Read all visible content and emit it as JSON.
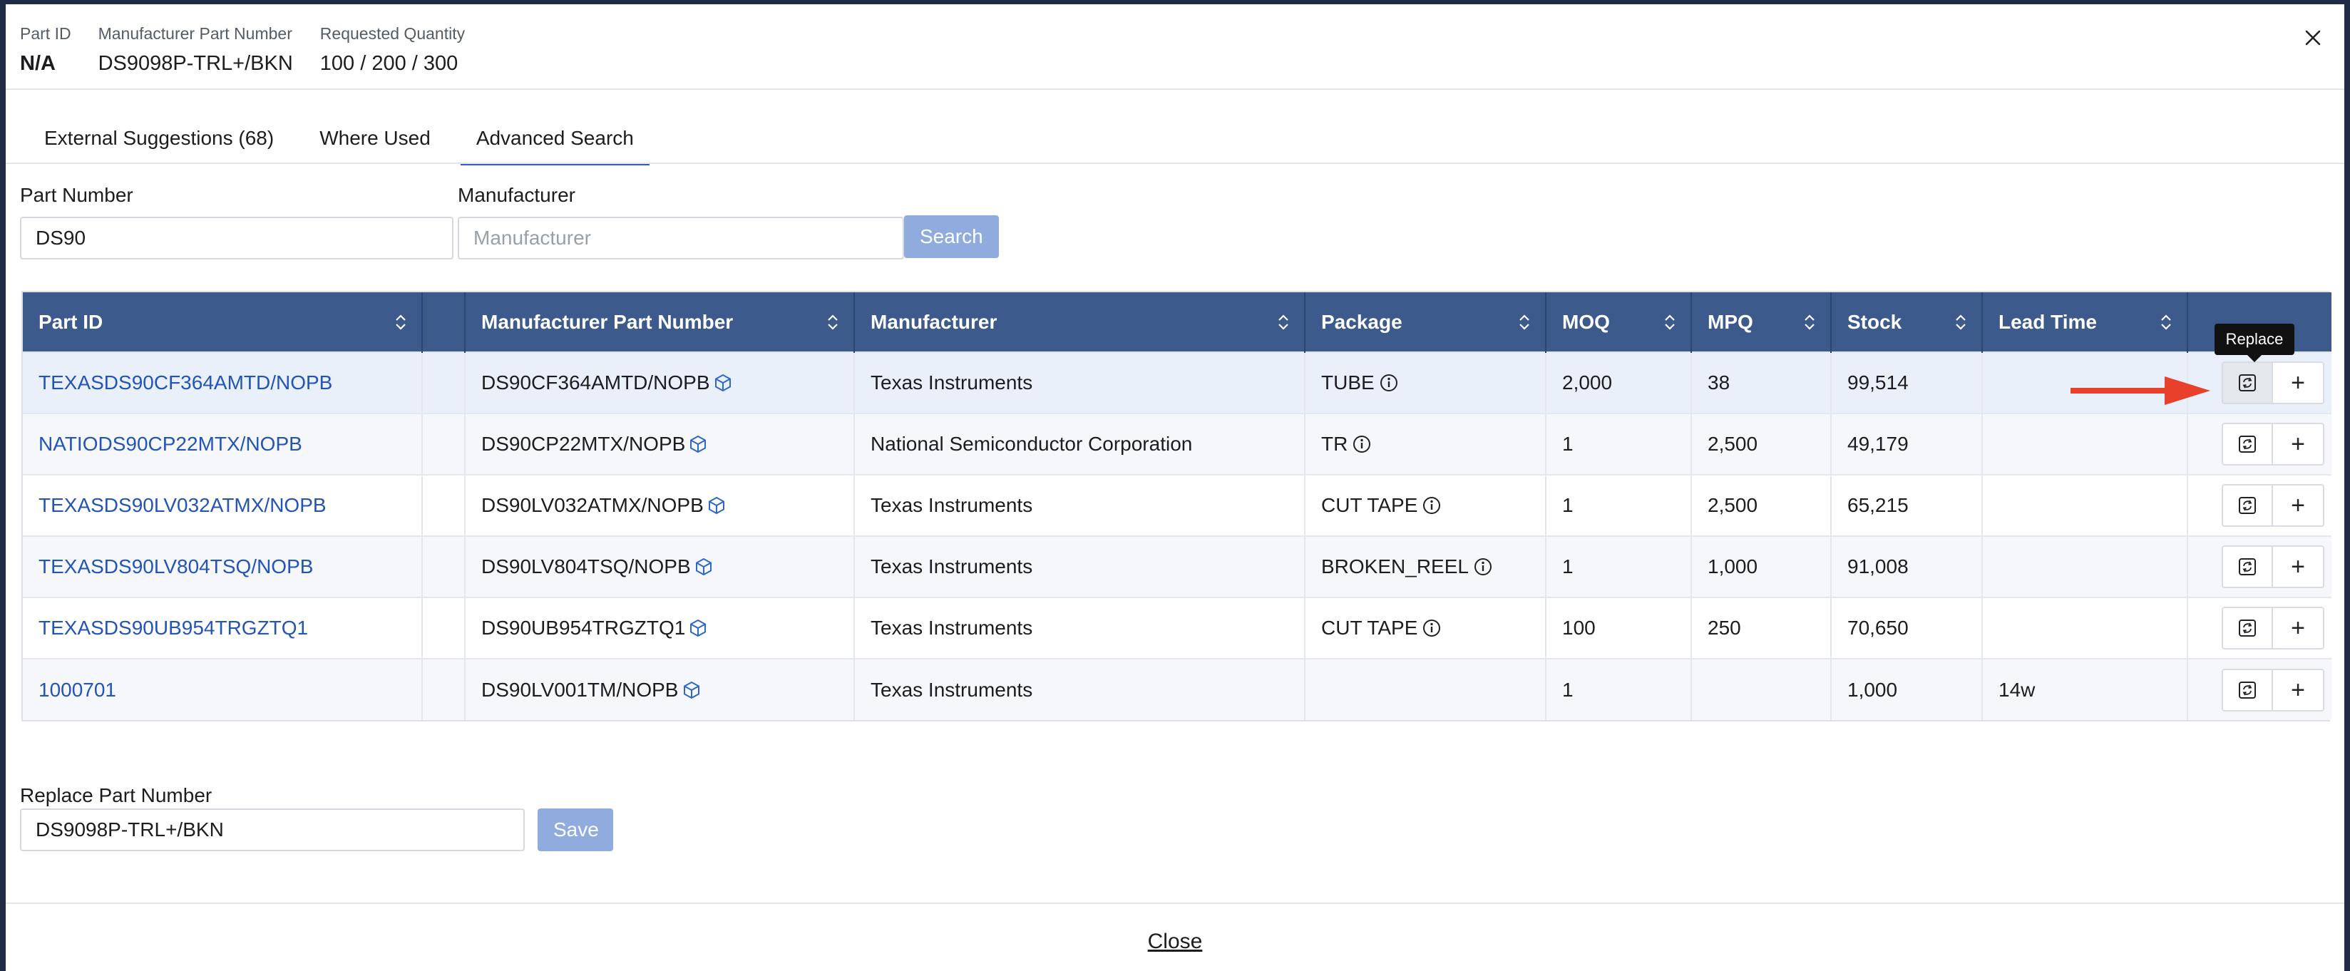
{
  "header": {
    "part_id_label": "Part ID",
    "part_id_value": "N/A",
    "mpn_label": "Manufacturer Part Number",
    "mpn_value": "DS9098P-TRL+/BKN",
    "qty_label": "Requested Quantity",
    "qty_value": "100 / 200 / 300",
    "close_icon": "close-icon"
  },
  "tabs": [
    {
      "label": "External Suggestions (68)",
      "active": false
    },
    {
      "label": "Where Used",
      "active": false
    },
    {
      "label": "Advanced Search",
      "active": true
    }
  ],
  "search": {
    "part_number_label": "Part Number",
    "part_number_value": "DS90",
    "manufacturer_label": "Manufacturer",
    "manufacturer_placeholder": "Manufacturer",
    "search_button": "Search"
  },
  "table": {
    "columns": [
      "Part ID",
      "",
      "Manufacturer Part Number",
      "Manufacturer",
      "Package",
      "MOQ",
      "MPQ",
      "Stock",
      "Lead Time",
      ""
    ],
    "rows": [
      {
        "part_id": "TEXASDS90CF364AMTD/NOPB",
        "mpn": "DS90CF364AMTD/NOPB",
        "manufacturer": "Texas Instruments",
        "package": "TUBE",
        "moq": "2,000",
        "mpq": "38",
        "stock": "99,514",
        "lead_time": ""
      },
      {
        "part_id": "NATIODS90CP22MTX/NOPB",
        "mpn": "DS90CP22MTX/NOPB",
        "manufacturer": "National Semiconductor Corporation",
        "package": "TR",
        "moq": "1",
        "mpq": "2,500",
        "stock": "49,179",
        "lead_time": ""
      },
      {
        "part_id": "TEXASDS90LV032ATMX/NOPB",
        "mpn": "DS90LV032ATMX/NOPB",
        "manufacturer": "Texas Instruments",
        "package": "CUT TAPE",
        "moq": "1",
        "mpq": "2,500",
        "stock": "65,215",
        "lead_time": ""
      },
      {
        "part_id": "TEXASDS90LV804TSQ/NOPB",
        "mpn": "DS90LV804TSQ/NOPB",
        "manufacturer": "Texas Instruments",
        "package": "BROKEN_REEL",
        "moq": "1",
        "mpq": "1,000",
        "stock": "91,008",
        "lead_time": ""
      },
      {
        "part_id": "TEXASDS90UB954TRGZTQ1",
        "mpn": "DS90UB954TRGZTQ1",
        "manufacturer": "Texas Instruments",
        "package": "CUT TAPE",
        "moq": "100",
        "mpq": "250",
        "stock": "70,650",
        "lead_time": ""
      },
      {
        "part_id": "1000701",
        "mpn": "DS90LV001TM/NOPB",
        "manufacturer": "Texas Instruments",
        "package": "",
        "moq": "1",
        "mpq": "",
        "stock": "1,000",
        "lead_time": "14w"
      }
    ],
    "tooltip": "Replace",
    "add_symbol": "+"
  },
  "replace": {
    "label": "Replace Part Number",
    "value": "DS9098P-TRL+/BKN",
    "save_button": "Save"
  },
  "footer": {
    "close_link": "Close"
  },
  "colors": {
    "table_header": "#3c5b8c",
    "link": "#2354b6",
    "primary_button": "#90acdf",
    "arrow": "#e8402a"
  }
}
